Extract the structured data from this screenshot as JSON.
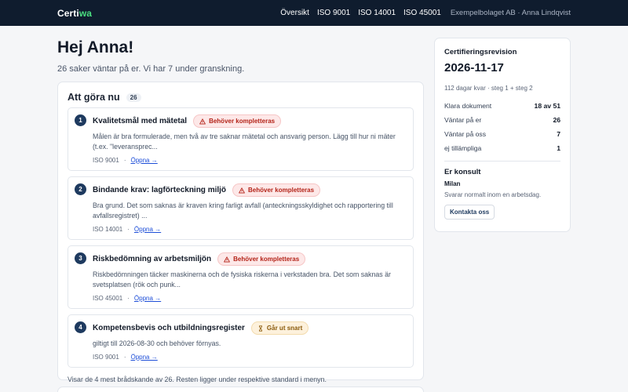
{
  "header": {
    "logo_part1": "Certi",
    "logo_part2": "wa",
    "nav": [
      "Översikt",
      "ISO 9001",
      "ISO 14001",
      "ISO 45001"
    ],
    "user": "Exempelbolaget AB · Anna Lindqvist"
  },
  "main": {
    "greeting": "Hej Anna!",
    "subtitle": "26 saker väntar på er. Vi har 7 under granskning."
  },
  "todo": {
    "title": "Att göra nu",
    "count": "26",
    "tasks": [
      {
        "num": "1",
        "title": "Kvalitetsmål med mätetal",
        "badge": "Behöver kompletteras",
        "badge_icon": "warning-icon",
        "desc": "Målen är bra formulerade, men två av tre saknar mätetal och ansvarig person. Lägg till hur ni mäter (t.ex. \"leveransprec...",
        "standard": "ISO 9001",
        "link": "Öppna →"
      },
      {
        "num": "2",
        "title": "Bindande krav: lagförteckning miljö",
        "badge": "Behöver kompletteras",
        "badge_icon": "warning-icon",
        "desc": "Bra grund. Det som saknas är kraven kring farligt avfall (anteckningsskyldighet och rapportering till avfallsregistret) ...",
        "standard": "ISO 14001",
        "link": "Öppna →"
      },
      {
        "num": "3",
        "title": "Riskbedömning av arbetsmiljön",
        "badge": "Behöver kompletteras",
        "badge_icon": "warning-icon",
        "desc": "Riskbedömningen täcker maskinerna och de fysiska riskerna i verkstaden bra. Det som saknas är svetsplatsen (rök och punk...",
        "standard": "ISO 45001",
        "link": "Öppna →"
      },
      {
        "num": "4",
        "title": "Kompetensbevis och utbildningsregister",
        "badge": "Går ut snart",
        "badge_icon": "hourglass-icon",
        "desc": "giltigt till 2026-08-30 och behöver förnyas.",
        "standard": "ISO 9001",
        "link": "Öppna →"
      }
    ],
    "footer": "Visar de 4 mest brådskande av 26. Resten ligger under respektive standard i menyn."
  },
  "sidebar": {
    "label": "Certifieringsrevision",
    "date": "2026-11-17",
    "meta": "112 dagar kvar · steg 1 + steg 2",
    "stats": [
      {
        "label": "Klara dokument",
        "value": "18 av 51"
      },
      {
        "label": "Väntar på er",
        "value": "26"
      },
      {
        "label": "Väntar på oss",
        "value": "7"
      },
      {
        "label": "ej tillämpliga",
        "value": "1"
      }
    ],
    "consult_title": "Er konsult",
    "consult_name": "Milan",
    "consult_note": "Svarar normalt inom en arbetsdag.",
    "contact_label": "Kontakta oss"
  },
  "colors": {
    "topbar": "#0f1c2e",
    "accent": "#4ade80",
    "warn": "#b42318",
    "soon": "#8a5a0b",
    "link": "#1d4ed8"
  }
}
